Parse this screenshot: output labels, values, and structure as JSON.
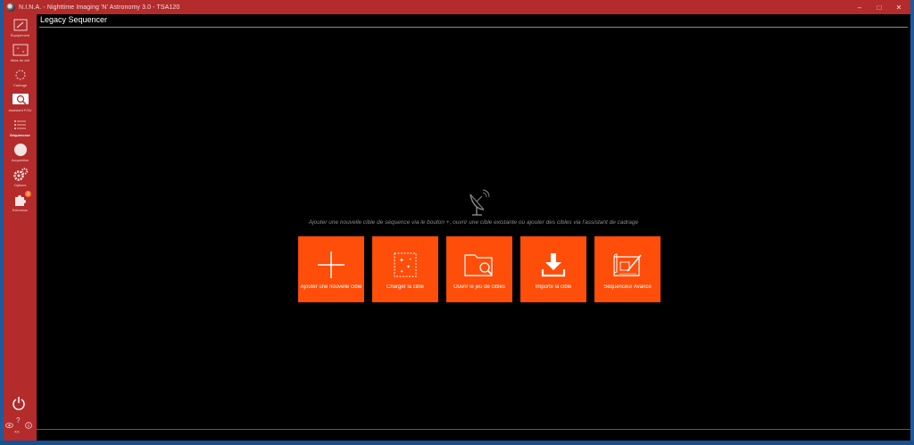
{
  "window": {
    "title": "N.I.N.A. - Nighttime Imaging 'N' Astronomy 3.0  -  TSA120",
    "controls": {
      "minimize": "–",
      "maximize": "□",
      "close": "✕"
    }
  },
  "sidebar": {
    "items": [
      {
        "label": "Équipement",
        "icon": "camera-icon"
      },
      {
        "label": "Atlas du ciel",
        "icon": "sky-atlas-icon"
      },
      {
        "label": "Cadrage",
        "icon": "framing-icon"
      },
      {
        "label": "Assistant FOU",
        "icon": "focus-icon"
      },
      {
        "label": "Séquenceur",
        "icon": "sequencer-icon"
      },
      {
        "label": "Acquisition",
        "icon": "imaging-icon"
      },
      {
        "label": "Options",
        "icon": "gear-icon"
      },
      {
        "label": "Extension",
        "icon": "puzzle-icon",
        "badge": "2"
      }
    ],
    "bottom": {
      "power": "⏻",
      "collapse": "<<"
    }
  },
  "main": {
    "title": "Legacy Sequencer",
    "hint": "Ajouter une nouvelle cible de séquence via le bouton +, ouvrir une cible existante ou ajouter des cibles via l'assistant de cadrage",
    "tiles": [
      {
        "label": "Ajouter une nouvelle cible",
        "icon": "plus-icon"
      },
      {
        "label": "Charger la cible",
        "icon": "star-map-icon"
      },
      {
        "label": "Ouvrir le jeu de cibles",
        "icon": "folder-search-icon"
      },
      {
        "label": "Importe la cible",
        "icon": "download-icon"
      },
      {
        "label": "Séquenceur Avancé",
        "icon": "blueprint-icon"
      }
    ]
  },
  "colors": {
    "accent": "#ff4d0a",
    "sidebar": "#b32b2b",
    "background": "#000000"
  }
}
